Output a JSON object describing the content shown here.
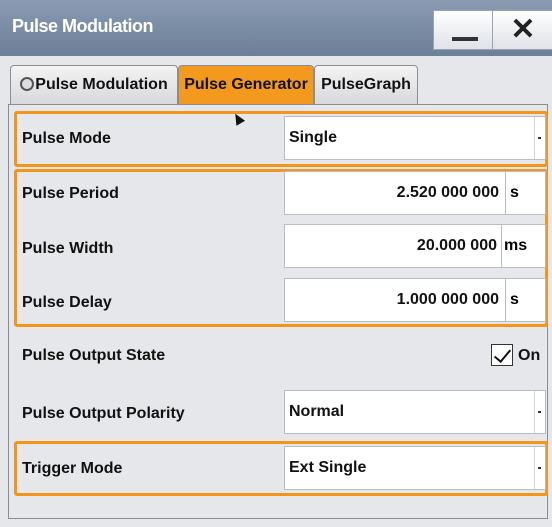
{
  "window": {
    "title": "Pulse Modulation",
    "min_label": "",
    "close_label": "✕"
  },
  "tabs": [
    {
      "label": "Pulse Modulation",
      "active": false
    },
    {
      "label": "Pulse Generator",
      "active": true
    },
    {
      "label": "PulseGraph",
      "active": false
    }
  ],
  "pulse_mode": {
    "label": "Pulse Mode",
    "value": "Single"
  },
  "pulse_period": {
    "label": "Pulse Period",
    "value": "2.520 000 000",
    "unit": "s"
  },
  "pulse_width": {
    "label": "Pulse Width",
    "value": "20.000 000",
    "unit": "ms"
  },
  "pulse_delay": {
    "label": "Pulse Delay",
    "value": "1.000 000 000",
    "unit": "s"
  },
  "output_state": {
    "label": "Pulse Output State",
    "checked": true,
    "check_label": "On"
  },
  "output_polarity": {
    "label": "Pulse Output Polarity",
    "value": "Normal"
  },
  "trigger_mode": {
    "label": "Trigger Mode",
    "value": "Ext Single"
  },
  "colors": {
    "accent": "#f2951a",
    "titlebar": "#7a8ca4",
    "panel": "#e6e7ea"
  }
}
